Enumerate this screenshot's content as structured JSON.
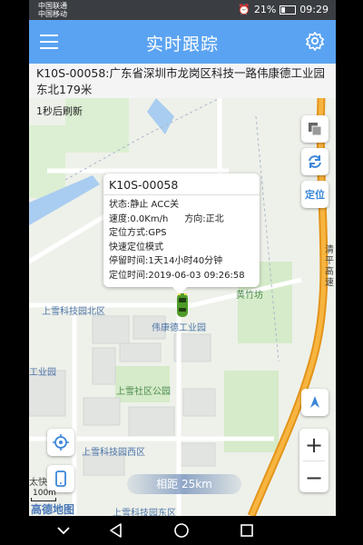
{
  "status_bar": {
    "carrier_1": "中国联通",
    "carrier_2": "中国移动",
    "battery": "21%",
    "time": "09:29"
  },
  "header": {
    "title": "实时跟踪",
    "menu_icon": "menu-icon",
    "settings_icon": "gear-icon"
  },
  "address": "K10S-00058:广东省深圳市龙岗区科技一路伟康德工业园东北179米",
  "map": {
    "refresh_text": "1秒后刷新",
    "labels": {
      "park_north": "上雪科技园北区",
      "weikangde": "伟康德工业园",
      "huangzhuyuan": "黄竹坊",
      "park_left": "工业园",
      "community_park": "上雪社区公园",
      "park_west": "上雪科技园西区",
      "park_east": "上雪科技园东区",
      "tai_kuai": "太快",
      "expressway": "清平高速"
    },
    "controls": {
      "layer_icon": "layers-icon",
      "refresh_icon": "refresh-icon",
      "locate_label": "定位",
      "navigate_icon": "navigation-arrow-icon",
      "zoom_in": "+",
      "zoom_out": "−",
      "track_icon": "target-icon",
      "phone_icon": "phone-icon"
    },
    "scale": "100m",
    "distance": "相距 25km",
    "logo": "高德地图"
  },
  "popup": {
    "title": "K10S-00058",
    "status": "状态:静止 ACC关",
    "speed": "速度:0.0Km/h",
    "direction": "方向:正北",
    "positioning": "定位方式:GPS",
    "mode": "快速定位模式",
    "stay_time": "停留时间:1天14小时40分钟",
    "locate_time": "定位时间:2019-06-03 09:26:58"
  },
  "android_nav": {
    "back_icon": "back-triangle-icon",
    "home_icon": "home-circle-icon",
    "recents_icon": "recents-square-icon",
    "down_icon": "chevron-down-icon"
  },
  "colors": {
    "header_bg": "#5aa3f2",
    "road_orange": "#f2a31b",
    "water": "#a9cdf0",
    "green_area": "#cfe8c2"
  }
}
